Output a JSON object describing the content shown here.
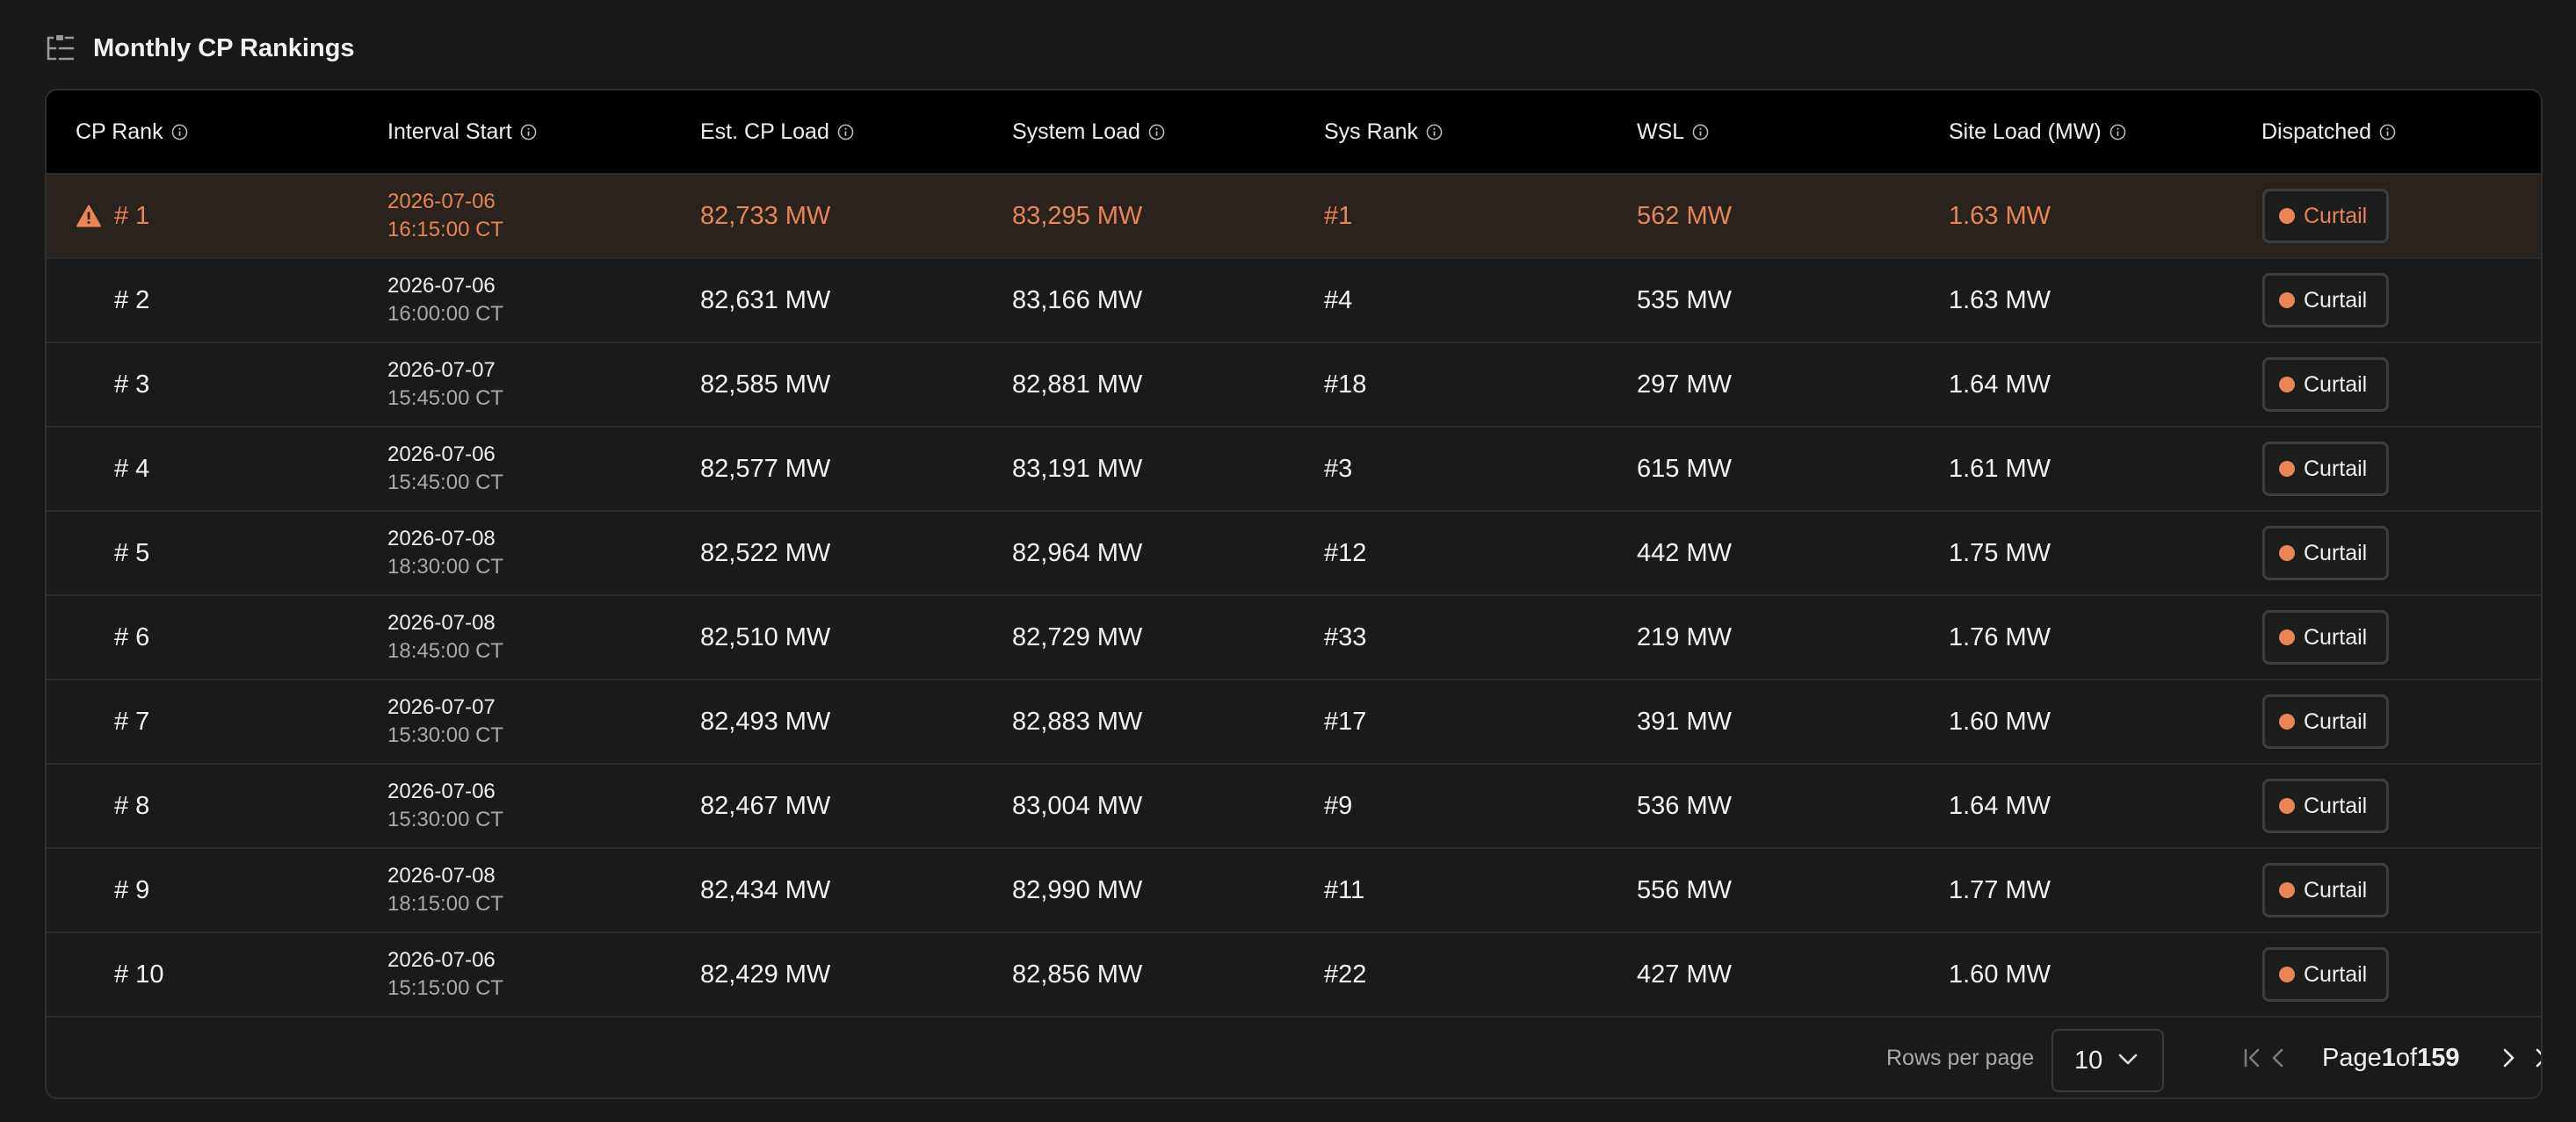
{
  "header": {
    "title": "Monthly CP Rankings",
    "icon": "list-tree-icon"
  },
  "columns": [
    {
      "key": "cp_rank",
      "label": "CP Rank"
    },
    {
      "key": "interval_start",
      "label": "Interval Start"
    },
    {
      "key": "est_cp_load",
      "label": "Est. CP Load"
    },
    {
      "key": "system_load",
      "label": "System Load"
    },
    {
      "key": "sys_rank",
      "label": "Sys Rank"
    },
    {
      "key": "wsl",
      "label": "WSL"
    },
    {
      "key": "site_load",
      "label": "Site Load (MW)"
    },
    {
      "key": "dispatched",
      "label": "Dispatched"
    }
  ],
  "rows": [
    {
      "rank": "# 1",
      "date": "2026-07-06",
      "time": "16:15:00 CT",
      "est": "82,733 MW",
      "sys": "83,295 MW",
      "sysrank": "#1",
      "wsl": "562 MW",
      "site": "1.63 MW",
      "dispatch": "Curtail",
      "highlight": true
    },
    {
      "rank": "# 2",
      "date": "2026-07-06",
      "time": "16:00:00 CT",
      "est": "82,631 MW",
      "sys": "83,166 MW",
      "sysrank": "#4",
      "wsl": "535 MW",
      "site": "1.63 MW",
      "dispatch": "Curtail"
    },
    {
      "rank": "# 3",
      "date": "2026-07-07",
      "time": "15:45:00 CT",
      "est": "82,585 MW",
      "sys": "82,881 MW",
      "sysrank": "#18",
      "wsl": "297 MW",
      "site": "1.64 MW",
      "dispatch": "Curtail"
    },
    {
      "rank": "# 4",
      "date": "2026-07-06",
      "time": "15:45:00 CT",
      "est": "82,577 MW",
      "sys": "83,191 MW",
      "sysrank": "#3",
      "wsl": "615 MW",
      "site": "1.61 MW",
      "dispatch": "Curtail"
    },
    {
      "rank": "# 5",
      "date": "2026-07-08",
      "time": "18:30:00 CT",
      "est": "82,522 MW",
      "sys": "82,964 MW",
      "sysrank": "#12",
      "wsl": "442 MW",
      "site": "1.75 MW",
      "dispatch": "Curtail"
    },
    {
      "rank": "# 6",
      "date": "2026-07-08",
      "time": "18:45:00 CT",
      "est": "82,510 MW",
      "sys": "82,729 MW",
      "sysrank": "#33",
      "wsl": "219 MW",
      "site": "1.76 MW",
      "dispatch": "Curtail"
    },
    {
      "rank": "# 7",
      "date": "2026-07-07",
      "time": "15:30:00 CT",
      "est": "82,493 MW",
      "sys": "82,883 MW",
      "sysrank": "#17",
      "wsl": "391 MW",
      "site": "1.60 MW",
      "dispatch": "Curtail"
    },
    {
      "rank": "# 8",
      "date": "2026-07-06",
      "time": "15:30:00 CT",
      "est": "82,467 MW",
      "sys": "83,004 MW",
      "sysrank": "#9",
      "wsl": "536 MW",
      "site": "1.64 MW",
      "dispatch": "Curtail"
    },
    {
      "rank": "# 9",
      "date": "2026-07-08",
      "time": "18:15:00 CT",
      "est": "82,434 MW",
      "sys": "82,990 MW",
      "sysrank": "#11",
      "wsl": "556 MW",
      "site": "1.77 MW",
      "dispatch": "Curtail"
    },
    {
      "rank": "# 10",
      "date": "2026-07-06",
      "time": "15:15:00 CT",
      "est": "82,429 MW",
      "sys": "82,856 MW",
      "sysrank": "#22",
      "wsl": "427 MW",
      "site": "1.60 MW",
      "dispatch": "Curtail"
    }
  ],
  "pagination": {
    "rows_per_page_label": "Rows per page",
    "rows_per_page_value": "10",
    "page_word": "Page",
    "current_page": "1",
    "of_word": "of",
    "total_pages": "159"
  },
  "colors": {
    "accent": "#e88455",
    "highlight_row_bg": "#2a231d",
    "header_bg": "#000000",
    "page_bg": "#181818"
  },
  "icons": {
    "info": "info-icon",
    "warning": "warning-triangle-icon",
    "status_dot": "status-dot",
    "chevron_down": "chevron-down-icon",
    "first_page": "first-page-icon",
    "prev_page": "chevron-left-icon",
    "next_page": "chevron-right-icon",
    "last_page": "last-page-icon"
  }
}
